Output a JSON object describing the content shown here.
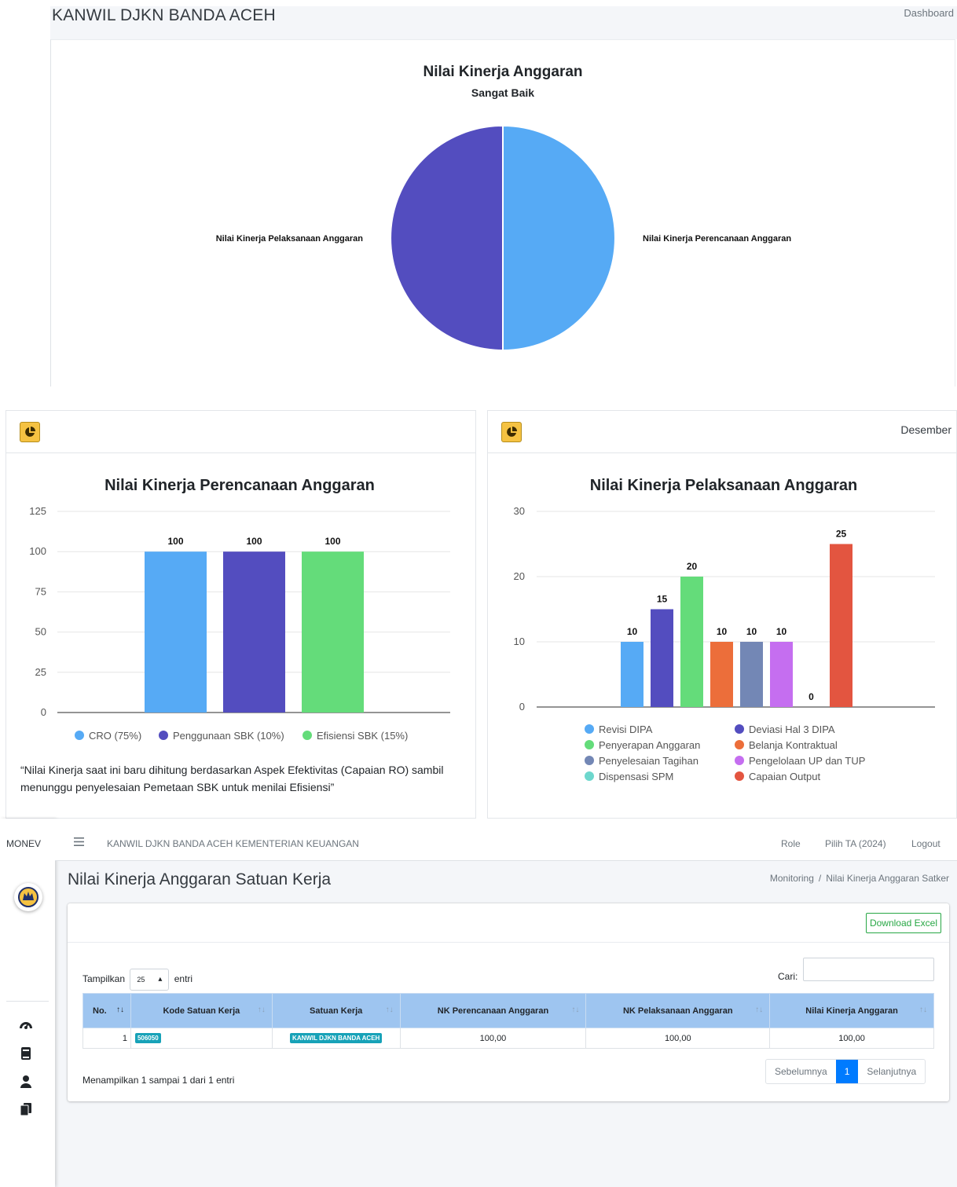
{
  "header": {
    "org_title": "KANWIL DJKN BANDA ACEH",
    "dashboard_link": "Dashboard"
  },
  "colors": {
    "blue": "#56aaf5",
    "indigo": "#534dbf",
    "green": "#64dc7a",
    "orange": "#ec6e3a",
    "slate": "#7387b5",
    "violet": "#c56ef0",
    "teal": "#6dd7cd",
    "red": "#e35540",
    "brand_yellow": "#f5c242"
  },
  "icons": {
    "card_icon": "pie-chart-icon",
    "menu": "hamburger-icon",
    "sidebar": [
      "dashboard-gauge-icon",
      "book-icon",
      "user-icon",
      "files-icon"
    ]
  },
  "right_card": {
    "period": "Desember"
  },
  "note_text": "“Nilai Kinerja saat ini baru dihitung berdasarkan Aspek Efektivitas (Capaian RO) sambil menunggu penyelesaian Pemetaan SBK untuk menilai Efisiensi”",
  "chart_data": [
    {
      "type": "pie",
      "title": "Nilai Kinerja Anggaran",
      "subtitle": "Sangat Baik",
      "slices": [
        {
          "label": "Nilai Kinerja Perencanaan Anggaran",
          "value": 50,
          "color": "#56aaf5"
        },
        {
          "label": "Nilai Kinerja Pelaksanaan Anggaran",
          "value": 50,
          "color": "#534dbf"
        }
      ]
    },
    {
      "type": "bar",
      "title": "Nilai Kinerja Perencanaan Anggaran",
      "ylim": [
        0,
        125
      ],
      "yticks": [
        0,
        25,
        50,
        75,
        100,
        125
      ],
      "grid": true,
      "legend_position": "bottom",
      "series": [
        {
          "name": "CRO (75%)",
          "value": 100,
          "color": "#56aaf5"
        },
        {
          "name": "Penggunaan SBK (10%)",
          "value": 100,
          "color": "#534dbf"
        },
        {
          "name": "Efisiensi SBK (15%)",
          "value": 100,
          "color": "#64dc7a"
        }
      ]
    },
    {
      "type": "bar",
      "title": "Nilai Kinerja Pelaksanaan Anggaran",
      "ylim": [
        0,
        30
      ],
      "yticks": [
        0,
        10,
        20,
        30
      ],
      "grid": true,
      "legend_position": "bottom",
      "series": [
        {
          "name": "Revisi DIPA",
          "value": 10,
          "color": "#56aaf5"
        },
        {
          "name": "Deviasi Hal 3 DIPA",
          "value": 15,
          "color": "#534dbf"
        },
        {
          "name": "Penyerapan Anggaran",
          "value": 20,
          "color": "#64dc7a"
        },
        {
          "name": "Belanja Kontraktual",
          "value": 10,
          "color": "#ec6e3a"
        },
        {
          "name": "Penyelesaian Tagihan",
          "value": 10,
          "color": "#7387b5"
        },
        {
          "name": "Pengelolaan UP dan TUP",
          "value": 10,
          "color": "#c56ef0"
        },
        {
          "name": "Dispensasi SPM",
          "value": 0,
          "color": "#6dd7cd"
        },
        {
          "name": "Capaian Output",
          "value": 25,
          "color": "#e35540"
        }
      ]
    }
  ],
  "app": {
    "brand": "MONEV",
    "nav_title": "KANWIL DJKN BANDA ACEH KEMENTERIAN KEUANGAN",
    "nav_links": [
      "Role",
      "Pilih TA (2024)",
      "Logout"
    ],
    "page_title": "Nilai Kinerja Anggaran Satuan Kerja",
    "breadcrumb": [
      "Monitoring",
      "Nilai Kinerja Anggaran Satker"
    ],
    "breadcrumb_sep": "/",
    "download_label": "Download Excel",
    "length_label_pre": "Tampilkan",
    "length_value": "25",
    "length_label_post": "entri",
    "search_label": "Cari:",
    "table": {
      "columns": [
        "No.",
        "Kode Satuan Kerja",
        "Satuan Kerja",
        "NK Perencanaan Anggaran",
        "NK Pelaksanaan Anggaran",
        "Nilai Kinerja Anggaran"
      ],
      "rows": [
        {
          "no": "1",
          "kode": "506050",
          "satker": "KANWIL DJKN BANDA ACEH",
          "nk_perencanaan": "100,00",
          "nk_pelaksanaan": "100,00",
          "nka": "100,00"
        }
      ]
    },
    "info_text": "Menampilkan 1 sampai 1 dari 1 entri",
    "pager": {
      "prev": "Sebelumnya",
      "current": "1",
      "next": "Selanjutnya"
    }
  }
}
